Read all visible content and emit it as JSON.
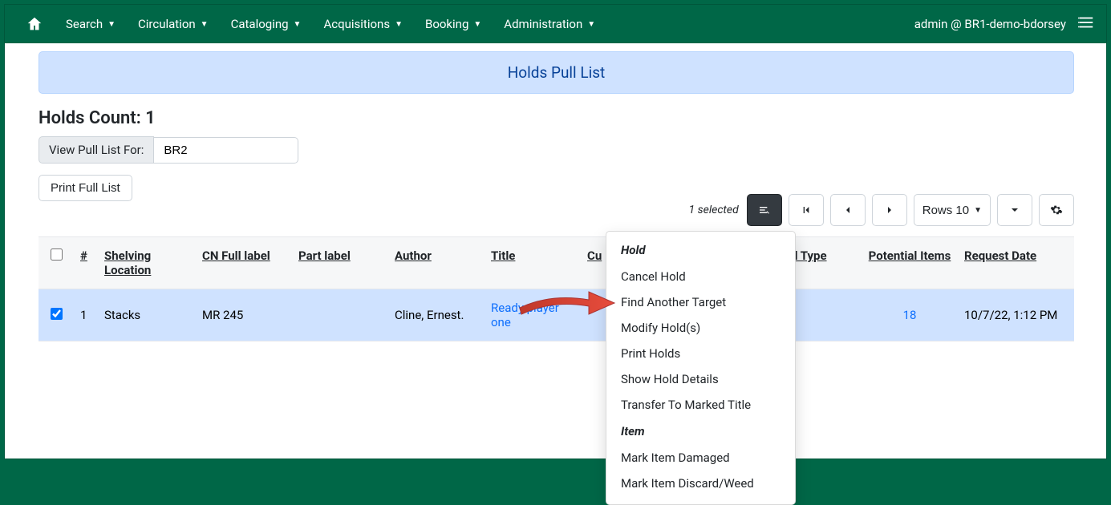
{
  "nav": {
    "items": [
      "Search",
      "Circulation",
      "Cataloging",
      "Acquisitions",
      "Booking",
      "Administration"
    ],
    "user_label": "admin @ BR1-demo-bdorsey"
  },
  "page": {
    "banner_title": "Holds Pull List",
    "holds_count_label": "Holds Count: 1",
    "view_label": "View Pull List For:",
    "view_value": "BR2",
    "print_label": "Print Full List",
    "selected_label": "1 selected",
    "rows_label": "Rows 10"
  },
  "columns": {
    "num": "#",
    "shelving": "Shelving Location",
    "cn": "CN Full label",
    "part": "Part label",
    "author": "Author",
    "title": "Title",
    "copy": "Cu",
    "holdtype": "ld Type",
    "potential": "Potential Items",
    "reqdate": "Request Date"
  },
  "rows": [
    {
      "checked": true,
      "num": "1",
      "shelving": "Stacks",
      "cn": "MR 245",
      "part": "",
      "author": "Cline, Ernest.",
      "title": "Ready player one",
      "copy": "",
      "holdtype": "",
      "potential": "18",
      "reqdate": "10/7/22, 1:12 PM"
    }
  ],
  "menu": {
    "section1": "Hold",
    "items1": [
      "Cancel Hold",
      "Find Another Target",
      "Modify Hold(s)",
      "Print Holds",
      "Show Hold Details",
      "Transfer To Marked Title"
    ],
    "section2": "Item",
    "items2": [
      "Mark Item Damaged",
      "Mark Item Discard/Weed"
    ]
  }
}
